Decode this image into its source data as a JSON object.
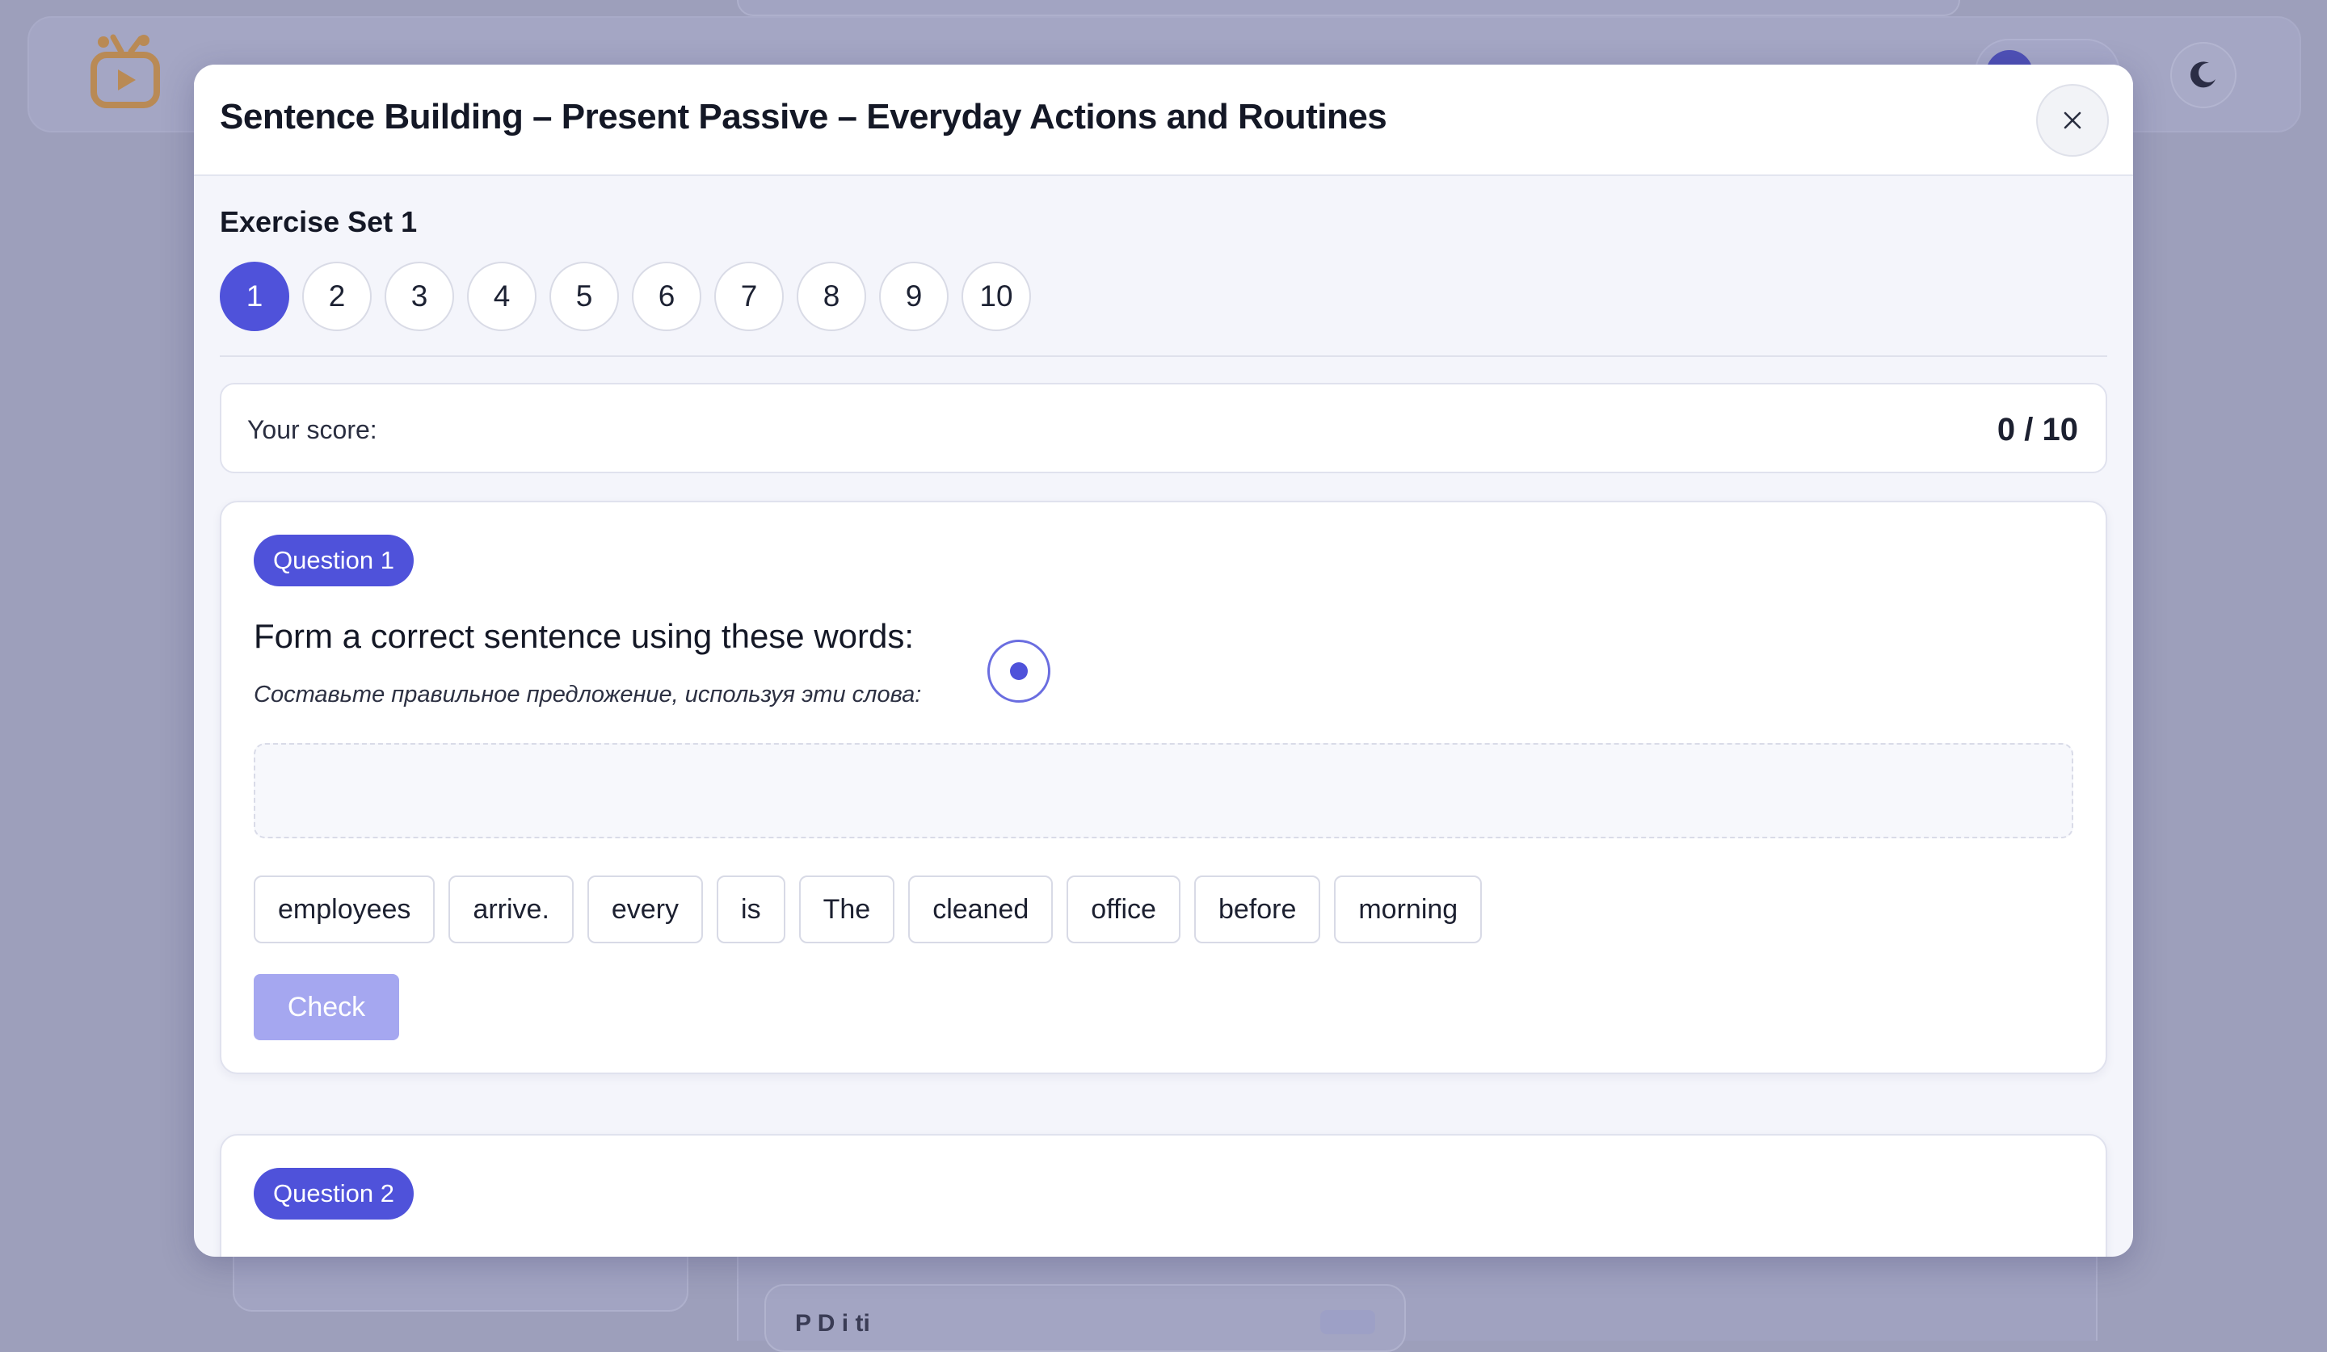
{
  "modal": {
    "title": "Sentence Building – Present Passive – Everyday Actions and Routines",
    "exercise_set_label": "Exercise Set 1",
    "question_numbers": [
      "1",
      "2",
      "3",
      "4",
      "5",
      "6",
      "7",
      "8",
      "9",
      "10"
    ],
    "active_question": "1",
    "score": {
      "label": "Your score:",
      "value": "0 / 10"
    }
  },
  "questions": [
    {
      "badge": "Question 1",
      "prompt": "Form a correct sentence using these words:",
      "prompt_translation": "Составьте правильное предложение, используя эти слова:",
      "answer": "",
      "words": [
        "employees",
        "arrive.",
        "every",
        "is",
        "The",
        "cleaned",
        "office",
        "before",
        "morning"
      ],
      "check_label": "Check",
      "check_enabled": false
    },
    {
      "badge": "Question 2"
    }
  ],
  "background": {
    "partial_text": "P       D     i   ti"
  },
  "colors": {
    "accent": "#4f52da",
    "accent_disabled": "#a5a7f0",
    "logo": "#c8965a"
  },
  "icons": {
    "close": "close-icon",
    "audio": "audio-play-icon",
    "theme": "moon-icon",
    "logo": "tv-logo-icon"
  }
}
